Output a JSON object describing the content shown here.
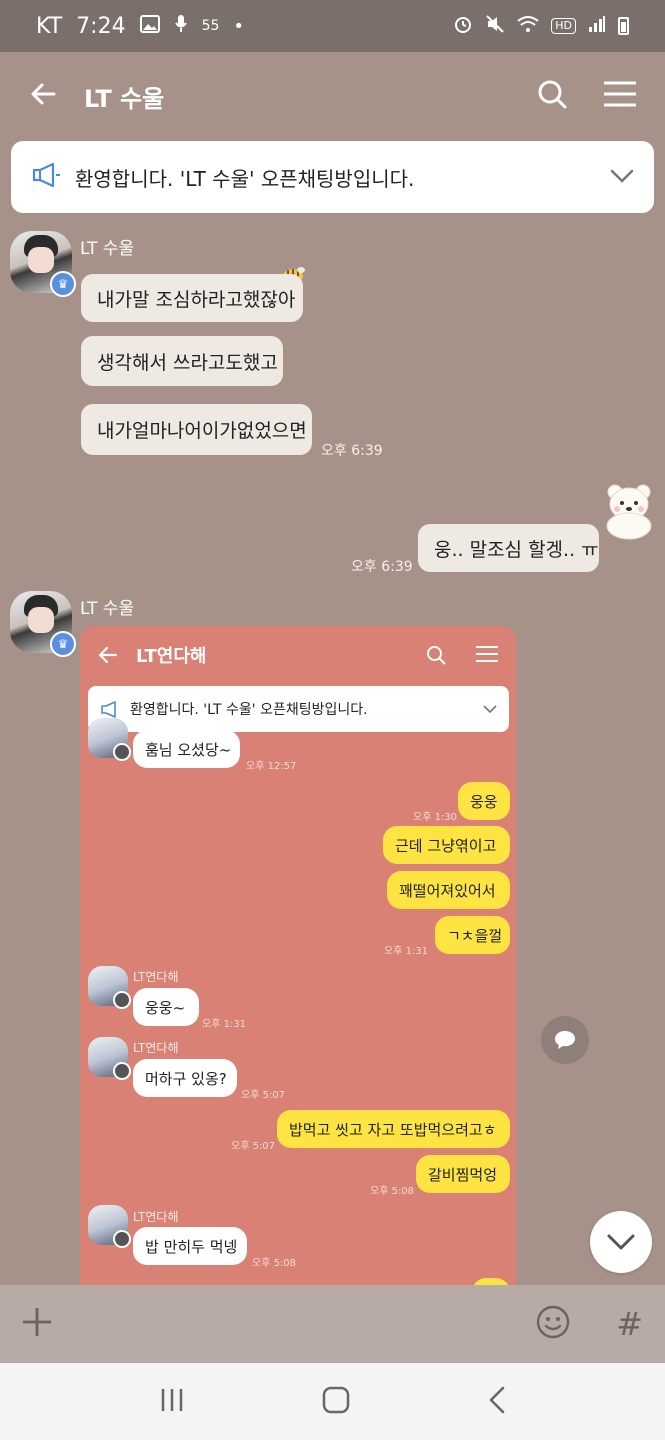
{
  "status_bar": {
    "carrier": "KT",
    "time": "7:24",
    "data_label": "55"
  },
  "header": {
    "title": "LT 수울"
  },
  "notice": {
    "text": "환영합니다. 'LT 수울' 오픈채팅방입니다."
  },
  "messages": [
    {
      "sender": "LT 수울",
      "bubbles": [
        "내가말 조심하라고했잖아",
        "생각해서 쓰라고도했고",
        "내가얼마나어이가없었으면"
      ],
      "time": "오후 6:39"
    },
    {
      "mine": true,
      "text": "웅.. 말조심 할겡.. ㅠ",
      "time": "오후 6:39"
    },
    {
      "sender": "LT 수울"
    }
  ],
  "shared_screenshot": {
    "title": "LT연다해",
    "notice": "환영합니다. 'LT 수울' 오픈채팅방입니다.",
    "items": [
      {
        "text": "훔님 오셨당~",
        "time": "오후 12:57"
      },
      {
        "text": "웅웅",
        "time": "오후 1:30"
      },
      {
        "text": "근데 그냥엮이고"
      },
      {
        "text": "꽤떨어져있어서"
      },
      {
        "text": "ㄱㅊ을껄",
        "time": "오후 1:31"
      },
      {
        "sender": "LT연다해",
        "text": "웅웅~",
        "time": "오후 1:31"
      },
      {
        "sender": "LT연다해",
        "text": "머하구 있옹?",
        "time": "오후 5:07"
      },
      {
        "text": "밥먹고 씻고 자고 또밥먹으려고ㅎ",
        "time": "오후 5:07"
      },
      {
        "text": "갈비찜먹엉",
        "time": "오후 5:08"
      },
      {
        "sender": "LT연다해",
        "text": "밥 만히두 먹넹",
        "time": "오후 5:08"
      }
    ]
  },
  "colors": {
    "background": "#a69289",
    "bubble": "#efe9e3",
    "screenshot_bg": "#d98174",
    "yellow_bubble": "#fde442"
  }
}
